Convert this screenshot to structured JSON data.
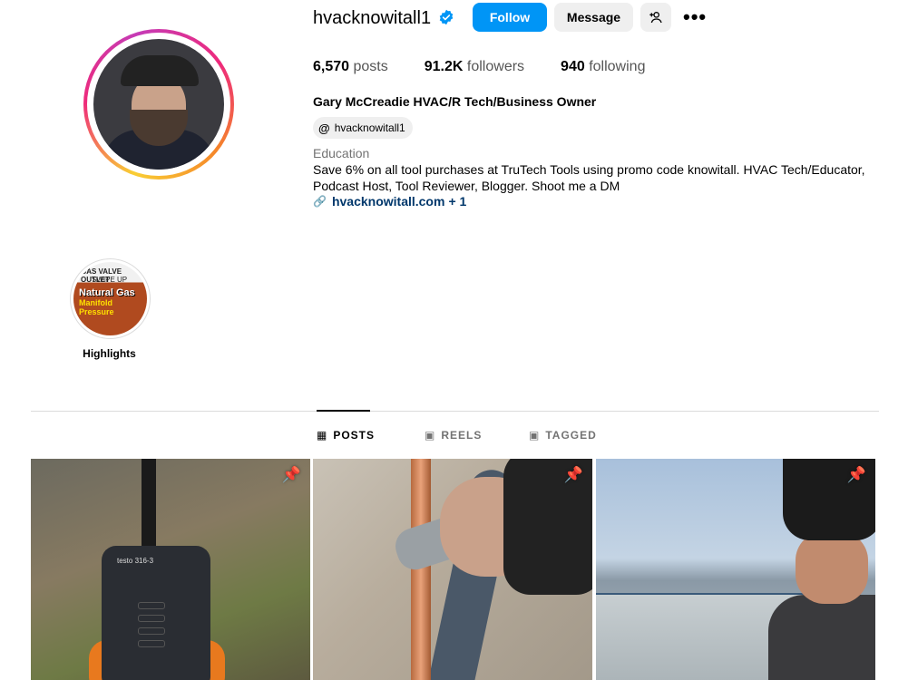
{
  "profile": {
    "username": "hvacknowitall1",
    "follow_label": "Follow",
    "message_label": "Message",
    "stats": [
      {
        "value": "6,570",
        "label": "posts"
      },
      {
        "value": "91.2K",
        "label": "followers"
      },
      {
        "value": "940",
        "label": "following"
      }
    ],
    "full_name": "Gary McCreadie HVAC/R Tech/Business Owner",
    "threads_handle": "hvacknowitall1",
    "category": "Education",
    "bio": "Save 6% on all tool purchases at TruTech Tools using promo code knowitall. HVAC Tech/Educator, Podcast Host, Tool Reviewer, Blogger. Shoot me a DM",
    "link_text": "hvacknowitall.com",
    "link_extra": "+ 1"
  },
  "highlights": {
    "label": "Highlights",
    "thumb_text": [
      "GAS VALVE OUTLET",
      "SWIPE UP",
      "Natural Gas",
      "Manifold Pressure"
    ]
  },
  "tabs": [
    {
      "label": "POSTS",
      "icon": "grid-icon",
      "active": true
    },
    {
      "label": "REELS",
      "icon": "reels-icon",
      "active": false
    },
    {
      "label": "TAGGED",
      "icon": "tagged-icon",
      "active": false
    }
  ],
  "posts": [
    {
      "pinned": true,
      "overlay_text": "testo 316-3"
    },
    {
      "pinned": true
    },
    {
      "pinned": true
    }
  ],
  "colors": {
    "accent": "#0095f6",
    "link": "#00376b",
    "secondary_text": "#737373",
    "button_bg": "#efefef"
  }
}
